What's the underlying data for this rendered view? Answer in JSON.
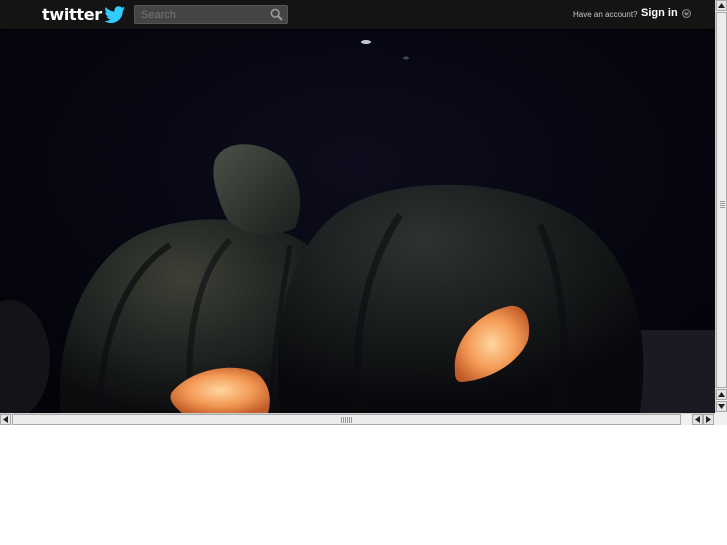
{
  "header": {
    "logo_text": "twitter",
    "logo_icon": "twitter-bird-icon",
    "search_placeholder": "Search",
    "account_prompt": "Have an account?",
    "signin_label": "Sign in"
  },
  "icons": {
    "search": "search-icon",
    "signin_dropdown": "chevron-down-icon"
  },
  "colors": {
    "topbar": "#141414",
    "brand_bird": "#33ccff",
    "background_photo": "#05050f",
    "pumpkin_glow": "#f5a050"
  },
  "image": {
    "subject": "carved jack-o'-lantern pumpkins at night"
  }
}
